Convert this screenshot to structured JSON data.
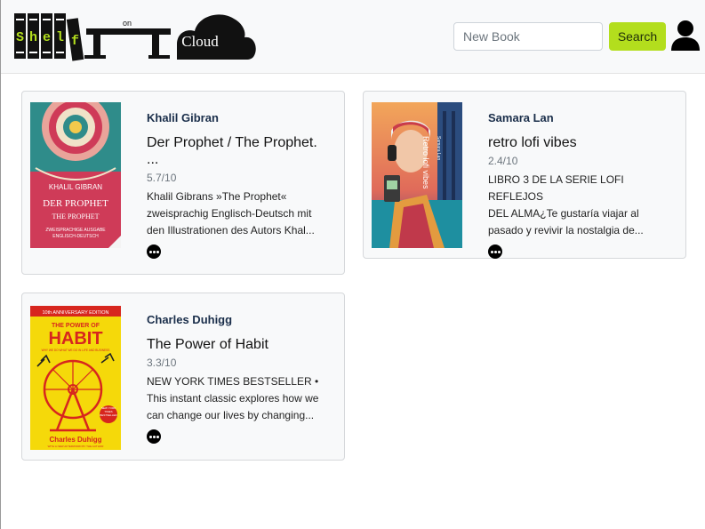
{
  "header": {
    "logo": {
      "letters": [
        "S",
        "h",
        "e",
        "l",
        "f"
      ],
      "on": "on",
      "cloud": "Cloud"
    },
    "search": {
      "placeholder": "New Book",
      "button_label": "Search"
    }
  },
  "books": [
    {
      "author": "Khalil Gibran",
      "title_line1": "Der Prophet / The Prophet.",
      "title_line2": "...",
      "rating": "5.7/10",
      "description": [
        "Khalil Gibrans »The Prophet«",
        "zweisprachig Englisch-Deutsch mit",
        "den Illustrationen des Autors Khal..."
      ],
      "cover": {
        "author": "KHALIL GIBRAN",
        "title": "DER PROPHET",
        "subtitle": "THE PROPHET",
        "line1": "ZWEISPRACHIGE AUSGABE",
        "line2": "ENGLISCH-DEUTSCH"
      }
    },
    {
      "author": "Samara Lan",
      "title_line1": "retro lofi vibes",
      "title_line2": "",
      "rating": "2.4/10",
      "description": [
        "LIBRO 3 DE LA SERIE LOFI REFLEJOS",
        "DEL ALMA¿Te gustaría viajar al",
        "pasado y revivir la nostalgia de..."
      ],
      "cover": {
        "title": "Retro lofi vibes",
        "author": "Samara Lan"
      }
    },
    {
      "author": "Charles Duhigg",
      "title_line1": "The Power of Habit",
      "title_line2": "",
      "rating": "3.3/10",
      "description": [
        "NEW YORK TIMES BESTSELLER •",
        "This instant classic explores how we",
        "can change our lives by changing..."
      ],
      "cover": {
        "edition": "10th ANNIVERSARY EDITION",
        "the_power_of": "THE POWER OF",
        "habit": "HABIT",
        "tagline1": "WHY WE DO WHAT WE DO IN LIFE AND BUSINESS",
        "badge": "NEW YORK TIMES BESTSELLER",
        "author": "Charles Duhigg",
        "tagline2": "WITH A NEW AFTERWORD BY THE AUTHOR"
      }
    }
  ]
}
